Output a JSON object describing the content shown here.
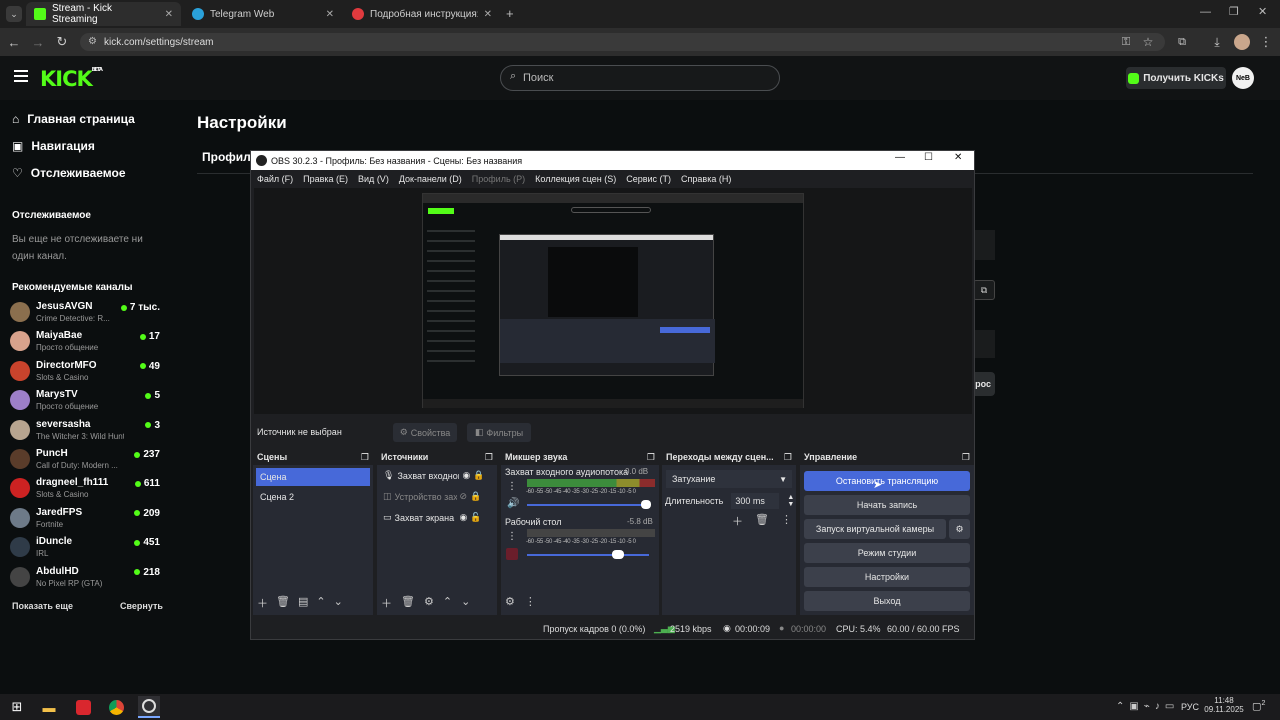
{
  "browser": {
    "tabs": [
      {
        "title": "Stream - Kick Streaming",
        "active": true,
        "icon": "kick-icon",
        "color": "#53fc18"
      },
      {
        "title": "Telegram Web",
        "active": false,
        "icon": "telegram-icon",
        "color": "#2aa1da"
      },
      {
        "title": "Подробная инструкция: подк",
        "active": false,
        "icon": "opera-icon",
        "color": "#e03a3e"
      }
    ],
    "url": "kick.com/settings/stream"
  },
  "kick": {
    "search_placeholder": "Поиск",
    "get_kicks": "Получить KICKs",
    "user_avatar": "NeB",
    "nav": [
      {
        "label": "Главная страница",
        "icon": "home-icon"
      },
      {
        "label": "Навигация",
        "icon": "compass-icon"
      },
      {
        "label": "Отслеживаемое",
        "icon": "heart-icon"
      }
    ],
    "following_heading": "Отслеживаемое",
    "following_empty": [
      "Вы еще не отслеживаете ни",
      "один канал."
    ],
    "recommended_heading": "Рекомендуемые каналы",
    "channels": [
      {
        "name": "JesusAVGN",
        "game": "Crime Detective: R...",
        "viewers": "7 тыс.",
        "color": "#8b6f4e"
      },
      {
        "name": "MaiyaBae",
        "game": "Просто общение",
        "viewers": "17",
        "color": "#d8a28c"
      },
      {
        "name": "DirectorMFO",
        "game": "Slots & Casino",
        "viewers": "49",
        "color": "#c9432c"
      },
      {
        "name": "MarysTV",
        "game": "Просто общение",
        "viewers": "5",
        "color": "#9d7fc9"
      },
      {
        "name": "seversasha",
        "game": "The Witcher 3: Wild Hunt",
        "viewers": "3",
        "color": "#b7a48f"
      },
      {
        "name": "PuncH",
        "game": "Call of Duty: Modern ...",
        "viewers": "237",
        "color": "#5a3c2a"
      },
      {
        "name": "dragneel_fh111",
        "game": "Slots & Casino",
        "viewers": "611",
        "color": "#cc2222"
      },
      {
        "name": "JaredFPS",
        "game": "Fortnite",
        "viewers": "209",
        "color": "#6d7a88"
      },
      {
        "name": "iDuncle",
        "game": "IRL",
        "viewers": "451",
        "color": "#2f3b48"
      },
      {
        "name": "AbdulHD",
        "game": "No Pixel RP (GTA)",
        "viewers": "218",
        "color": "#444"
      }
    ],
    "show_more": "Показать еще",
    "collapse": "Свернуть",
    "page_title": "Настройки",
    "tab_profile": "Профиль",
    "reset_partial": "рос"
  },
  "obs": {
    "title": "OBS 30.2.3 - Профиль: Без названия - Сцены: Без названия",
    "menu": [
      "Файл (F)",
      "Правка (E)",
      "Вид (V)",
      "Док-панели (D)",
      "Профиль (P)",
      "Коллекция сцен (S)",
      "Сервис (T)",
      "Справка (H)"
    ],
    "no_source": "Источник не выбран",
    "properties": "Свойства",
    "filters": "Фильтры",
    "docks": {
      "scenes": {
        "title": "Сцены",
        "items": [
          "Сцена",
          "Сцена 2"
        ]
      },
      "sources": {
        "title": "Источники",
        "items": [
          "Захват входног",
          "Устройство зах",
          "Захват экрана"
        ]
      },
      "mixer": {
        "title": "Микшер звука",
        "channels": [
          {
            "name": "Захват входного аудиопотока",
            "db": "0.0 dB"
          },
          {
            "name": "Рабочий стол",
            "db": "-5.8 dB"
          }
        ],
        "scale": "-60 -55 -50 -45 -40 -35 -30 -25 -20 -15 -10 -5 0"
      },
      "transitions": {
        "title": "Переходы между сцен...",
        "type": "Затухание",
        "duration_label": "Длительность",
        "duration": "300 ms"
      },
      "controls": {
        "title": "Управление",
        "buttons": [
          "Остановить трансляцию",
          "Начать запись",
          "Запуск виртуальной камеры",
          "Режим студии",
          "Настройки",
          "Выход"
        ]
      }
    },
    "status": {
      "dropped": "Пропуск кадров 0 (0.0%)",
      "bitrate": "2519 kbps",
      "live_time": "00:00:09",
      "rec_time": "00:00:00",
      "cpu": "CPU: 5.4%",
      "fps": "60.00 / 60.00 FPS"
    }
  },
  "taskbar": {
    "lang": "РУС",
    "time": "11:48",
    "date": "09.11.2025",
    "notif_count": "2"
  }
}
